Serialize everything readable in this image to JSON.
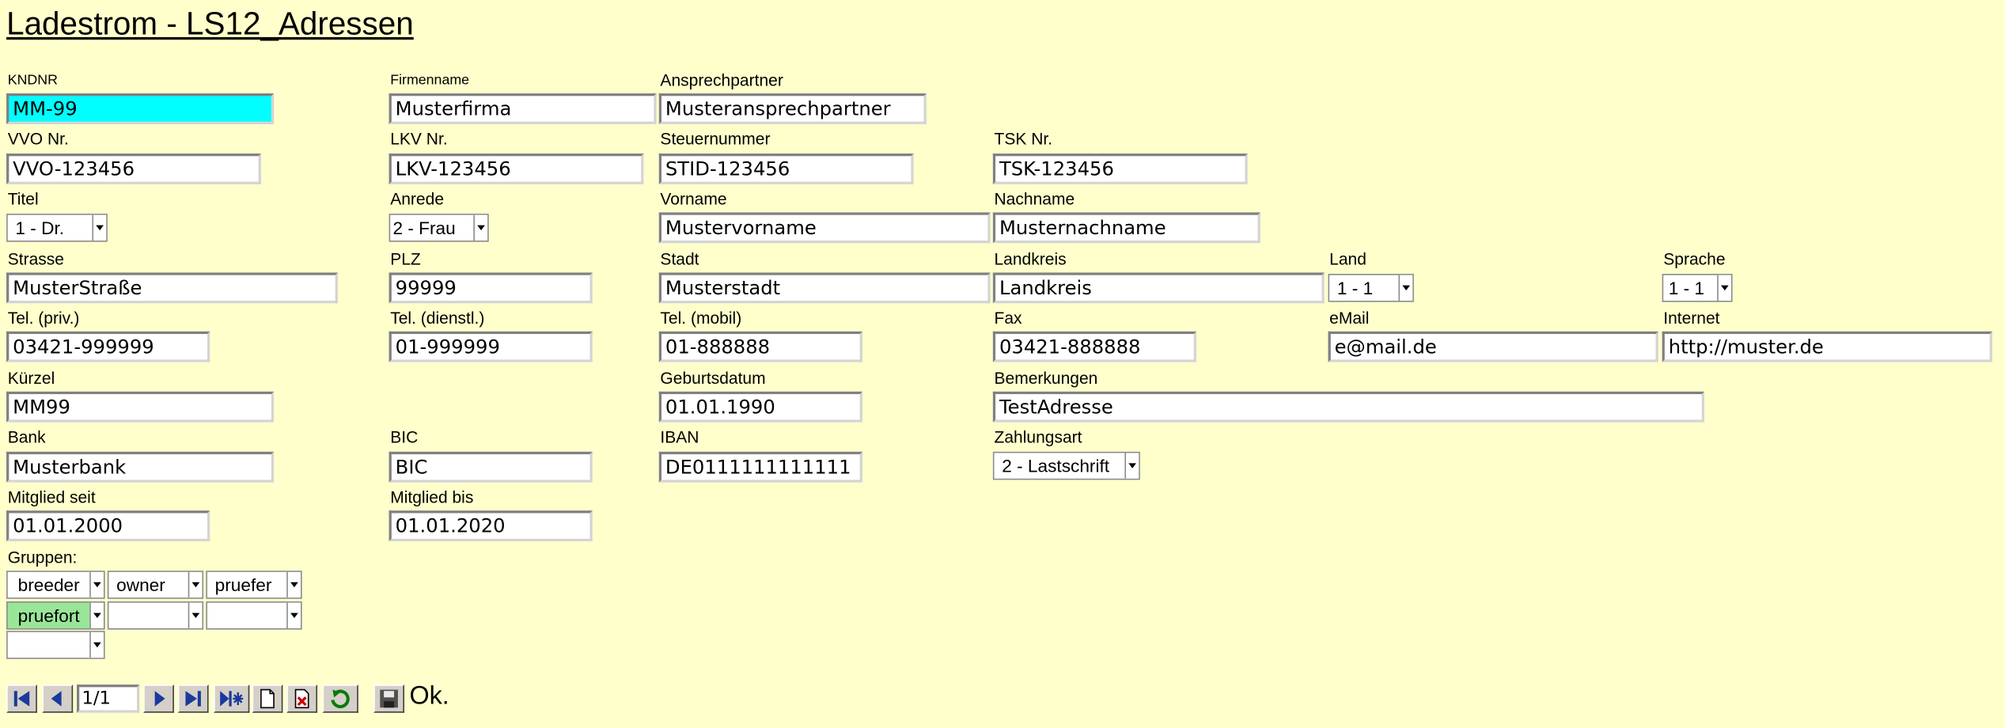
{
  "title": "Ladestrom - LS12_Adressen",
  "labels": {
    "kndnr": "KNDNR",
    "firmenname": "Firmenname",
    "ansprechpartner": "Ansprechpartner",
    "vvo": "VVO Nr.",
    "lkv": "LKV Nr.",
    "steuernummer": "Steuernummer",
    "tsk": "TSK Nr.",
    "titel": "Titel",
    "anrede": "Anrede",
    "vorname": "Vorname",
    "nachname": "Nachname",
    "strasse": "Strasse",
    "plz": "PLZ",
    "stadt": "Stadt",
    "landkreis": "Landkreis",
    "land": "Land",
    "sprache": "Sprache",
    "tel_priv": "Tel. (priv.)",
    "tel_dienstl": "Tel. (dienstl.)",
    "tel_mobil": "Tel. (mobil)",
    "fax": "Fax",
    "email": "eMail",
    "internet": "Internet",
    "kuerzel": "Kürzel",
    "geburtsdatum": "Geburtsdatum",
    "bemerkungen": "Bemerkungen",
    "bank": "Bank",
    "bic": "BIC",
    "iban": "IBAN",
    "zahlungsart": "Zahlungsart",
    "mitglied_seit": "Mitglied seit",
    "mitglied_bis": "Mitglied bis",
    "gruppen": "Gruppen:"
  },
  "values": {
    "kndnr": "MM-99",
    "firmenname": "Musterfirma",
    "ansprechpartner": "Musteransprechpartner",
    "vvo": "VVO-123456",
    "lkv": "LKV-123456",
    "steuernummer": "STID-123456",
    "tsk": "TSK-123456",
    "titel": "1 - Dr.",
    "anrede": "2 - Frau",
    "vorname": "Mustervorname",
    "nachname": "Musternachname",
    "strasse": "MusterStraße",
    "plz": "99999",
    "stadt": "Musterstadt",
    "landkreis": "Landkreis",
    "land": "1 - 1",
    "sprache": "1 - 1",
    "tel_priv": "03421-999999",
    "tel_dienstl": "01-999999",
    "tel_mobil": "01-888888",
    "fax": "03421-888888",
    "email": "e@mail.de",
    "internet": "http://muster.de",
    "kuerzel": "MM99",
    "geburtsdatum": "01.01.1990",
    "bemerkungen": "TestAdresse",
    "bank": "Musterbank",
    "bic": "BIC",
    "iban": "DE0111111111111",
    "zahlungsart": "2 - Lastschrift",
    "mitglied_seit": "01.01.2000",
    "mitglied_bis": "01.01.2020"
  },
  "gruppen": [
    "breeder",
    "owner",
    "pruefer",
    "pruefort",
    "",
    "",
    ""
  ],
  "nav": {
    "record": "1/1",
    "status": "Ok."
  },
  "icons": {
    "first": "first-record-icon",
    "prev": "previous-record-icon",
    "next": "next-record-icon",
    "last": "last-record-icon",
    "new": "new-record-icon",
    "blank": "blank-document-icon",
    "delete": "delete-record-icon",
    "refresh": "refresh-icon",
    "save": "save-icon"
  },
  "colors": {
    "background": "#ffffcc",
    "focused_field": "#00ffff",
    "group_highlight": "#99e699",
    "nav_icon": "#1a3a9c"
  }
}
